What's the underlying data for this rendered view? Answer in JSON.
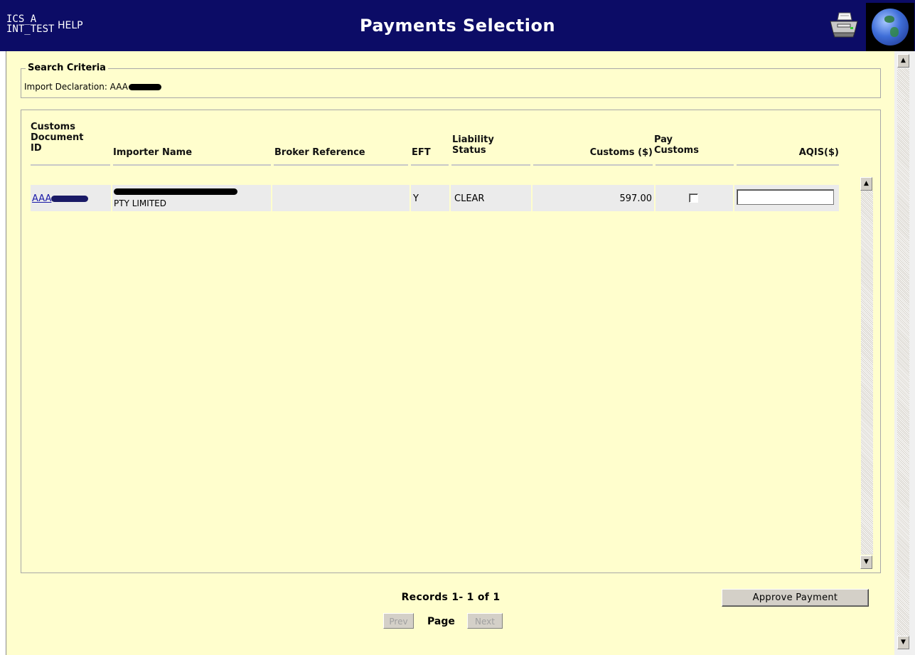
{
  "header": {
    "env_line1": "ICS_A",
    "env_line2": "INT_TEST",
    "help_label": "HELP",
    "title": "Payments Selection",
    "print_icon": "printer-icon",
    "globe_icon": "globe-icon"
  },
  "search_criteria": {
    "legend": "Search Criteria",
    "import_label": "Import Declaration: AAA"
  },
  "table": {
    "headers": {
      "doc_id_1": "Customs",
      "doc_id_2": "Document",
      "doc_id_3": "ID",
      "importer": "Importer Name",
      "broker": "Broker Reference",
      "eft": "EFT",
      "liability_1": "Liability",
      "liability_2": "Status",
      "customs_amt": "Customs ($)",
      "pay_1": "Pay",
      "pay_2": "Customs",
      "aqis": "AQIS($)"
    },
    "rows": [
      {
        "doc_id": "AAA",
        "importer_line2": "PTY LIMITED",
        "broker_ref": "",
        "eft": "Y",
        "liability_status": "CLEAR",
        "customs_amount": "597.00",
        "pay_customs_checked": false,
        "aqis_value": ""
      }
    ]
  },
  "footer": {
    "records": "Records 1- 1 of 1",
    "prev": "Prev",
    "page": "Page",
    "next": "Next",
    "approve": "Approve Payment"
  },
  "colors": {
    "header_bg": "#0c0c66",
    "panel_bg": "#fffecd",
    "row_bg": "#ebebeb",
    "link": "#1a1aa8"
  }
}
